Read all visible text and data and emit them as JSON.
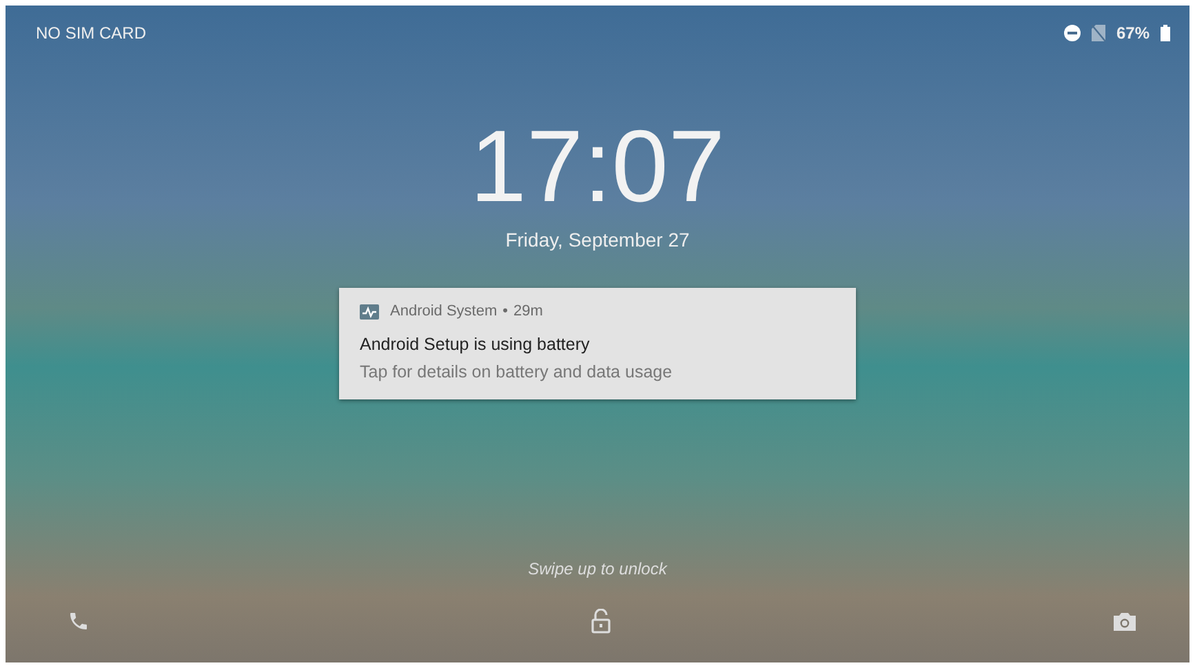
{
  "status_bar": {
    "carrier": "NO SIM CARD",
    "battery_percent": "67%"
  },
  "clock": {
    "time": "17:07",
    "date": "Friday, September 27"
  },
  "notification": {
    "app": "Android System",
    "separator": "•",
    "age": "29m",
    "title": "Android Setup is using battery",
    "text": "Tap for details on battery and data usage"
  },
  "hint": "Swipe up to unlock"
}
